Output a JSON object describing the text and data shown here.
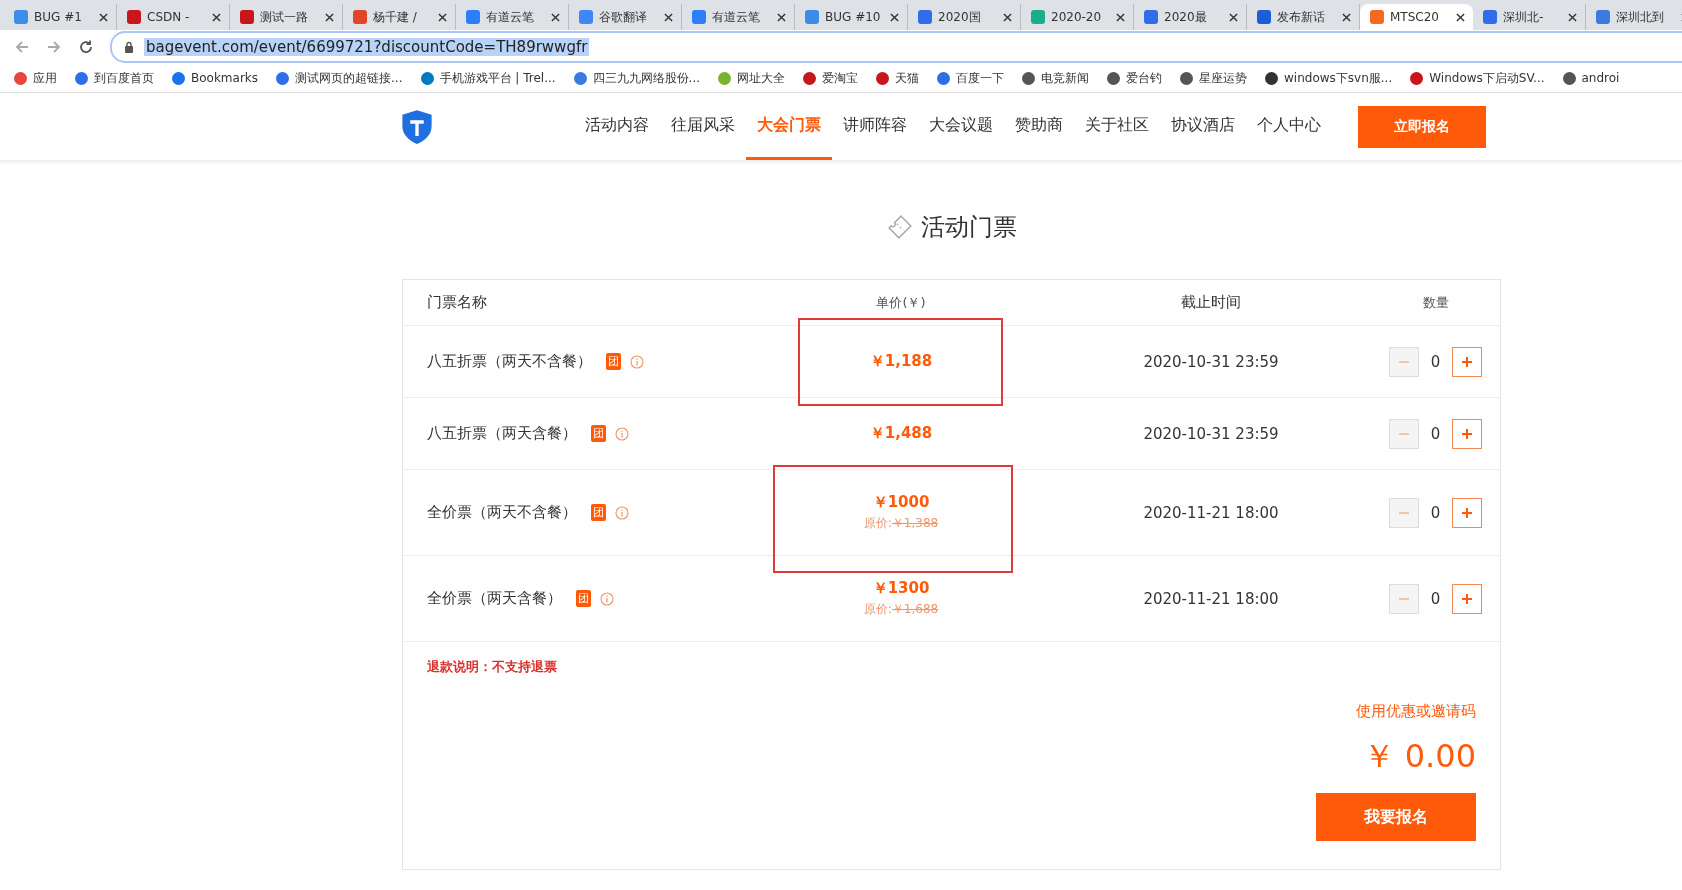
{
  "browser": {
    "tabs": [
      {
        "title": "BUG #1",
        "color": "#3b8ee8",
        "selected": false
      },
      {
        "title": "CSDN -",
        "color": "#c8161d",
        "selected": false
      },
      {
        "title": "测试一路",
        "color": "#c8161d",
        "selected": false
      },
      {
        "title": "杨千建 /",
        "color": "#e24329",
        "selected": false
      },
      {
        "title": "有道云笔",
        "color": "#2d7ff9",
        "selected": false
      },
      {
        "title": "谷歌翻译",
        "color": "#4285f4",
        "selected": false
      },
      {
        "title": "有道云笔",
        "color": "#2d7ff9",
        "selected": false
      },
      {
        "title": "BUG #10",
        "color": "#3b8ee8",
        "selected": false
      },
      {
        "title": "2020国",
        "color": "#2f6ee8",
        "selected": false
      },
      {
        "title": "2020-20",
        "color": "#1aad8b",
        "selected": false
      },
      {
        "title": "2020最",
        "color": "#2f6ee8",
        "selected": false
      },
      {
        "title": "发布新话",
        "color": "#1b5fd6",
        "selected": false
      },
      {
        "title": "MTSC20",
        "color": "#f56a1d",
        "selected": true
      },
      {
        "title": "深圳北-",
        "color": "#2f6ee8",
        "selected": false
      },
      {
        "title": "深圳北到",
        "color": "#3b7be0",
        "selected": false
      }
    ],
    "url": "bagevent.com/event/6699721?discountCode=TH89rwwgfr",
    "bookmarks": [
      {
        "label": "应用",
        "color": "#e8453c"
      },
      {
        "label": "到百度首页",
        "color": "#2f6ee8"
      },
      {
        "label": "Bookmarks",
        "color": "#1a73e8"
      },
      {
        "label": "测试网页的超链接...",
        "color": "#2f6ee8"
      },
      {
        "label": "手机游戏平台 | Trel...",
        "color": "#0079bf"
      },
      {
        "label": "四三九九网络股份...",
        "color": "#3b7be0"
      },
      {
        "label": "网址大全",
        "color": "#7bb32e"
      },
      {
        "label": "爱淘宝",
        "color": "#c8161d"
      },
      {
        "label": "天猫",
        "color": "#c8161d"
      },
      {
        "label": "百度一下",
        "color": "#2f6ee8"
      },
      {
        "label": "电竞新闻",
        "color": "#555555"
      },
      {
        "label": "爱台钓",
        "color": "#555555"
      },
      {
        "label": "星座运势",
        "color": "#555555"
      },
      {
        "label": "windows下svn服...",
        "color": "#333333"
      },
      {
        "label": "Windows下启动SV...",
        "color": "#c8161d"
      },
      {
        "label": "androi",
        "color": "#555555"
      }
    ]
  },
  "nav": {
    "items": [
      {
        "label": "活动内容",
        "selected": false
      },
      {
        "label": "往届风采",
        "selected": false
      },
      {
        "label": "大会门票",
        "selected": true
      },
      {
        "label": "讲师阵容",
        "selected": false
      },
      {
        "label": "大会议题",
        "selected": false
      },
      {
        "label": "赞助商",
        "selected": false
      },
      {
        "label": "关于社区",
        "selected": false
      },
      {
        "label": "协议酒店",
        "selected": false
      },
      {
        "label": "个人中心",
        "selected": false
      }
    ],
    "register_button": "立即报名"
  },
  "section_title": "活动门票",
  "table": {
    "columns": [
      "门票名称",
      "单价(￥)",
      "截止时间",
      "数量"
    ],
    "rows": [
      {
        "name": "八五折票（两天不含餐）",
        "badge": "团",
        "price": "￥1,188",
        "deadline": "2020-10-31 23:59",
        "quantity": "0",
        "highlighted": true
      },
      {
        "name": "八五折票（两天含餐）",
        "badge": "团",
        "price": "￥1,488",
        "deadline": "2020-10-31 23:59",
        "quantity": "0",
        "highlighted": false
      },
      {
        "name": "全价票（两天不含餐）",
        "badge": "团",
        "price": "￥1000",
        "original_label": "原价:",
        "original_price": "￥1,388",
        "deadline": "2020-11-21 18:00",
        "quantity": "0",
        "highlighted": true
      },
      {
        "name": "全价票（两天含餐）",
        "badge": "团",
        "price": "￥1300",
        "original_label": "原价:",
        "original_price": "￥1,688",
        "deadline": "2020-11-21 18:00",
        "quantity": "0",
        "highlighted": false
      }
    ]
  },
  "refund_note": "退款说明：不支持退票",
  "coupon_link": "使用优惠或邀请码",
  "total": "￥ 0.00",
  "submit_button": "我要报名"
}
